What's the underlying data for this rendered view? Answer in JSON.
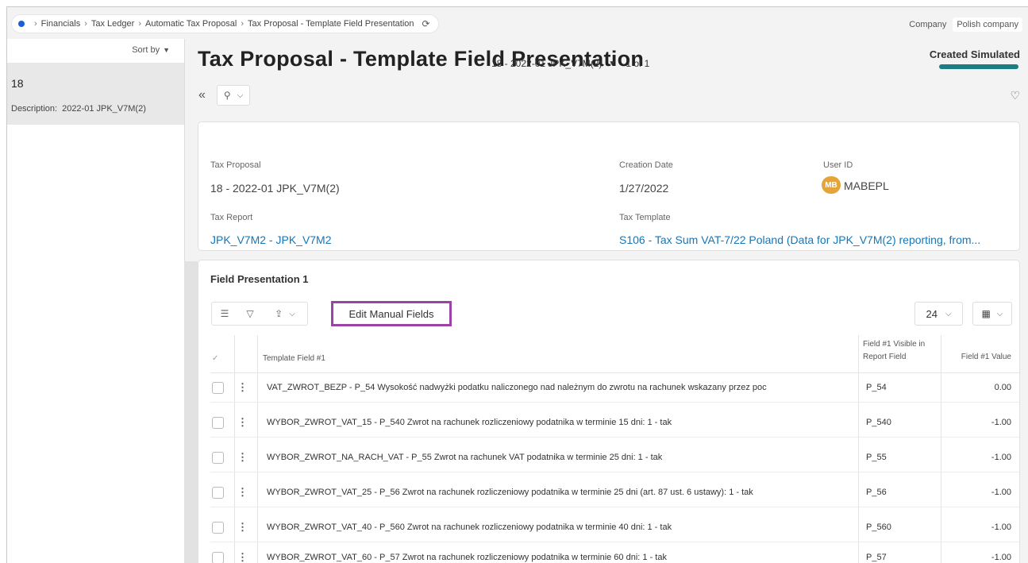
{
  "breadcrumb": {
    "items": [
      "Financials",
      "Tax Ledger",
      "Automatic Tax Proposal",
      "Tax Proposal - Template Field Presentation"
    ]
  },
  "company": {
    "label": "Company",
    "value": "Polish company"
  },
  "sidebar": {
    "sort_label": "Sort by",
    "items": [
      {
        "id": "18",
        "desc_label": "Description:",
        "desc_value": "2022-01 JPK_V7M(2)"
      }
    ]
  },
  "header": {
    "title": "Tax Proposal - Template Field Presentation",
    "record": "18 - 2022-01 JPK_V7M(2)",
    "count": "1 of 1",
    "status": "Created Simulated"
  },
  "details": {
    "tax_proposal_label": "Tax Proposal",
    "tax_proposal_value": "18 - 2022-01 JPK_V7M(2)",
    "creation_date_label": "Creation Date",
    "creation_date_value": "1/27/2022",
    "user_id_label": "User ID",
    "user_initials": "MB",
    "user_id_value": "MABEPL",
    "tax_report_label": "Tax Report",
    "tax_report_value": "JPK_V7M2 - JPK_V7M2",
    "tax_template_label": "Tax Template",
    "tax_template_value": "S106 - Tax Sum VAT-7/22 Poland (Data for JPK_V7M(2) reporting, from..."
  },
  "grid": {
    "title": "Field Presentation 1",
    "edit_button": "Edit Manual Fields",
    "page_size": "24",
    "columns": {
      "template_field": "Template Field #1",
      "visible_in_report_1": "Field #1 Visible in",
      "visible_in_report_2": "Report Field",
      "value": "Field #1 Value"
    },
    "rows": [
      {
        "field": "VAT_ZWROT_BEZP - P_54 Wysokość nadwyżki podatku naliczonego nad należnym do zwrotu na rachunek wskazany przez poc",
        "report": "P_54",
        "value": "0.00"
      },
      {
        "field": "WYBOR_ZWROT_VAT_15 - P_540 Zwrot na rachunek rozliczeniowy podatnika w terminie 15 dni: 1 - tak",
        "report": "P_540",
        "value": "-1.00"
      },
      {
        "field": "WYBOR_ZWROT_NA_RACH_VAT - P_55 Zwrot na rachunek VAT podatnika w terminie 25 dni: 1 - tak",
        "report": "P_55",
        "value": "-1.00"
      },
      {
        "field": "WYBOR_ZWROT_VAT_25 - P_56 Zwrot na rachunek rozliczeniowy podatnika w terminie 25 dni (art. 87 ust. 6 ustawy): 1 - tak",
        "report": "P_56",
        "value": "-1.00"
      },
      {
        "field": "WYBOR_ZWROT_VAT_40 - P_560 Zwrot na rachunek rozliczeniowy podatnika w terminie 40 dni: 1 - tak",
        "report": "P_560",
        "value": "-1.00"
      },
      {
        "field": "WYBOR_ZWROT_VAT_60 - P_57 Zwrot na rachunek rozliczeniowy podatnika w terminie 60 dni: 1 - tak",
        "report": "P_57",
        "value": "-1.00"
      }
    ]
  },
  "colors": {
    "accent": "#1a7f84",
    "link": "#1676b6",
    "highlight": "#9b44a6",
    "avatar": "#e5a43a"
  }
}
